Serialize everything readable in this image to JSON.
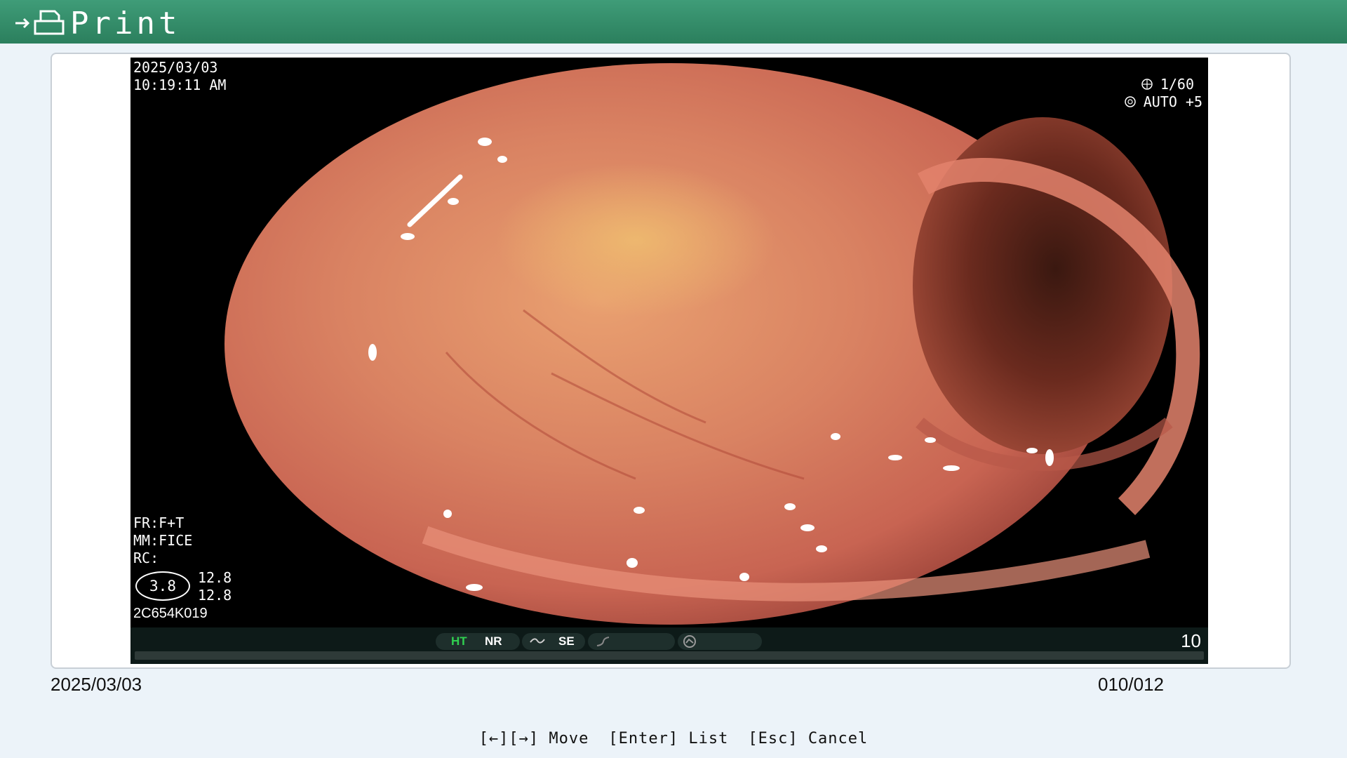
{
  "window": {
    "title": "Print",
    "icon": "print-icon"
  },
  "image_osd": {
    "date": "2025/03/03",
    "time": "10:19:11  AM",
    "shutter": "1/60",
    "shutter_icon": "shutter-icon",
    "auto_exposure": "AUTO +5",
    "auto_icon": "iris-icon",
    "fr": "FR:F+T",
    "mm": "MM:FICE",
    "rc": "RC:",
    "zoom_value": "3.8",
    "value_1": "12.8",
    "value_2": "12.8",
    "scope_serial": "2C654K019"
  },
  "status_bar": {
    "ht": "HT",
    "nr": "NR",
    "se": "SE",
    "frame_number": "10"
  },
  "footer": {
    "date": "2025/03/03",
    "index": "010/012"
  },
  "hints": {
    "move": "[←][→] Move",
    "list": "[Enter] List",
    "cancel": "[Esc] Cancel"
  },
  "colors": {
    "titlebar": "#2b7f5d",
    "background": "#ecf3f9",
    "ht_indicator": "#30d050"
  }
}
